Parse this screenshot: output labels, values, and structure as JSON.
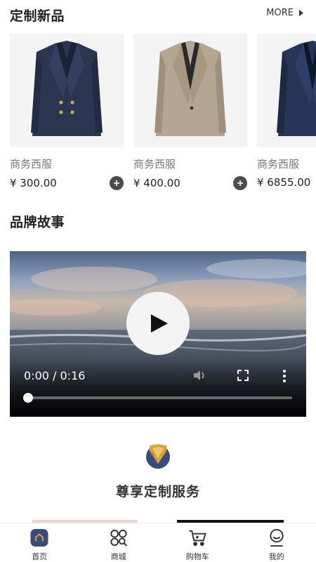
{
  "sections": {
    "new_products_title": "定制新品",
    "more_label": "MORE",
    "brand_story_title": "品牌故事",
    "service_title": "尊享定制服务"
  },
  "products": [
    {
      "name": "商务西服",
      "price": "¥ 300.00",
      "jacket_color": "#2b3750"
    },
    {
      "name": "商务西服",
      "price": "¥ 400.00",
      "jacket_color": "#b5a693"
    },
    {
      "name": "商务西服",
      "price": "¥ 6855.00",
      "jacket_color": "#273556"
    }
  ],
  "video": {
    "time": "0:00 / 0:16",
    "progress_fraction": 0
  },
  "tabs": [
    {
      "label": "首页",
      "icon": "home-icon",
      "active": true
    },
    {
      "label": "商城",
      "icon": "shop-grid-icon",
      "active": false
    },
    {
      "label": "购物车",
      "icon": "cart-icon",
      "active": false
    },
    {
      "label": "我的",
      "icon": "profile-icon",
      "active": false
    }
  ],
  "colors": {
    "accent_navy": "#3a4a7a",
    "accent_gold": "#d8a23a",
    "text_dark": "#222222",
    "text_muted": "#777777"
  }
}
